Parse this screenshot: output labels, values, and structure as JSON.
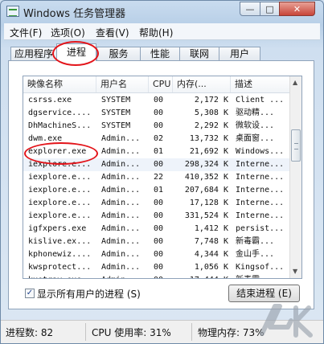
{
  "window": {
    "title": "Windows 任务管理器",
    "minimize": "—",
    "maximize": "□",
    "close": "✕"
  },
  "menu": [
    "文件(F)",
    "选项(O)",
    "查看(V)",
    "帮助(H)"
  ],
  "tabs": [
    "应用程序",
    "进程",
    "服务",
    "性能",
    "联网",
    "用户"
  ],
  "active_tab": "进程",
  "columns": [
    "映像名称",
    "用户名",
    "CPU",
    "内存(...",
    "描述"
  ],
  "rows": [
    {
      "name": "csrss.exe",
      "user": "SYSTEM",
      "cpu": "00",
      "mem": "2,172 K",
      "desc": "Client ..."
    },
    {
      "name": "dgservice....",
      "user": "SYSTEM",
      "cpu": "00",
      "mem": "5,308 K",
      "desc": "驱动精..."
    },
    {
      "name": "DhMachineS...",
      "user": "SYSTEM",
      "cpu": "00",
      "mem": "2,292 K",
      "desc": "微软设..."
    },
    {
      "name": "dwm.exe",
      "user": "Admin...",
      "cpu": "02",
      "mem": "13,732 K",
      "desc": "桌面窗..."
    },
    {
      "name": "explorer.exe",
      "user": "Admin...",
      "cpu": "01",
      "mem": "21,692 K",
      "desc": "Windows..."
    },
    {
      "name": "iexplore.e...",
      "user": "Admin...",
      "cpu": "00",
      "mem": "298,324 K",
      "desc": "Interne..."
    },
    {
      "name": "iexplore.e...",
      "user": "Admin...",
      "cpu": "22",
      "mem": "410,352 K",
      "desc": "Interne..."
    },
    {
      "name": "iexplore.e...",
      "user": "Admin...",
      "cpu": "01",
      "mem": "207,684 K",
      "desc": "Interne..."
    },
    {
      "name": "iexplore.e...",
      "user": "Admin...",
      "cpu": "00",
      "mem": "17,128 K",
      "desc": "Interne..."
    },
    {
      "name": "iexplore.e...",
      "user": "Admin...",
      "cpu": "00",
      "mem": "331,524 K",
      "desc": "Interne..."
    },
    {
      "name": "igfxpers.exe",
      "user": "Admin...",
      "cpu": "00",
      "mem": "1,412 K",
      "desc": "persist..."
    },
    {
      "name": "kislive.ex...",
      "user": "Admin...",
      "cpu": "00",
      "mem": "7,748 K",
      "desc": "新毒霸..."
    },
    {
      "name": "kphonewiz....",
      "user": "Admin...",
      "cpu": "00",
      "mem": "4,344 K",
      "desc": "金山手..."
    },
    {
      "name": "kwsprotect...",
      "user": "Admin...",
      "cpu": "00",
      "mem": "1,056 K",
      "desc": "Kingsof..."
    },
    {
      "name": "kxetray.exe",
      "user": "Admin...",
      "cpu": "00",
      "mem": "17,444 K",
      "desc": "新毒霸..."
    }
  ],
  "show_all_users": {
    "label": "显示所有用户的进程 (S)",
    "checked": true,
    "mark": "✓"
  },
  "end_process_button": "结束进程 (E)",
  "status": {
    "processes": "进程数: 82",
    "cpu": "CPU 使用率: 31%",
    "memory": "物理内存: 73%"
  },
  "scroll": {
    "up": "▲",
    "down": "▼"
  },
  "colors": {
    "highlight_oval": "#e3141a"
  }
}
